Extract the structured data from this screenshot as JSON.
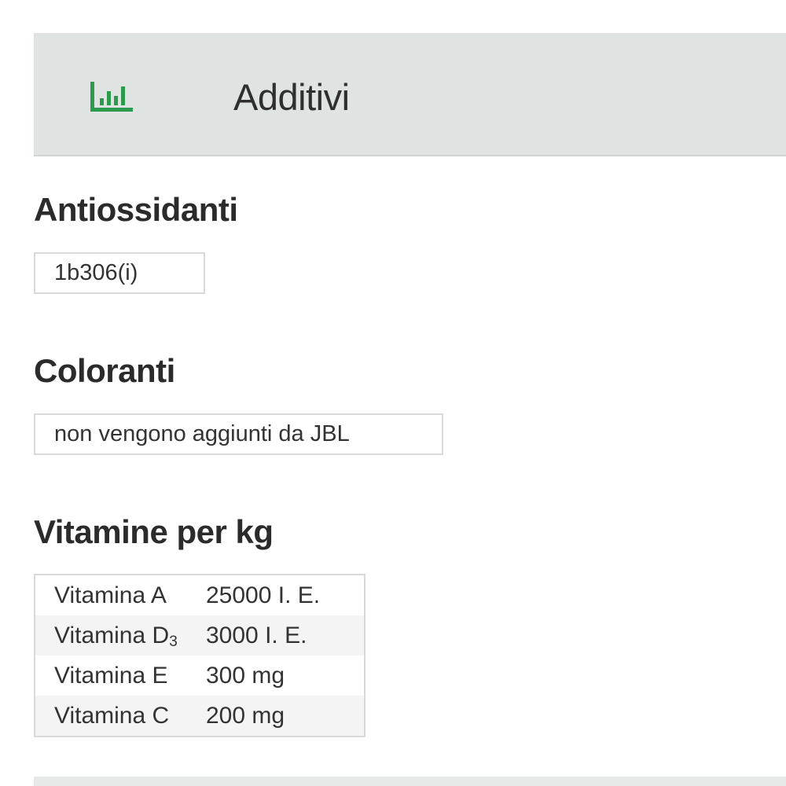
{
  "header": {
    "title": "Additivi",
    "icon": "bar-chart-icon",
    "icon_color": "#2b9a4a",
    "background": "#dfe3e1"
  },
  "sections": {
    "antioxidants": {
      "title": "Antiossidanti",
      "value": "1b306(i)"
    },
    "colorants": {
      "title": "Coloranti",
      "value": "non vengono aggiunti da JBL"
    },
    "vitamins": {
      "title": "Vitamine per kg",
      "rows": [
        {
          "name": "Vitamina A",
          "subscript": "",
          "value": "25000 I. E."
        },
        {
          "name": "Vitamina D",
          "subscript": "3",
          "value": "3000 I. E."
        },
        {
          "name": "Vitamina E",
          "subscript": "",
          "value": "300 mg"
        },
        {
          "name": "Vitamina C",
          "subscript": "",
          "value": "200 mg"
        }
      ]
    }
  }
}
